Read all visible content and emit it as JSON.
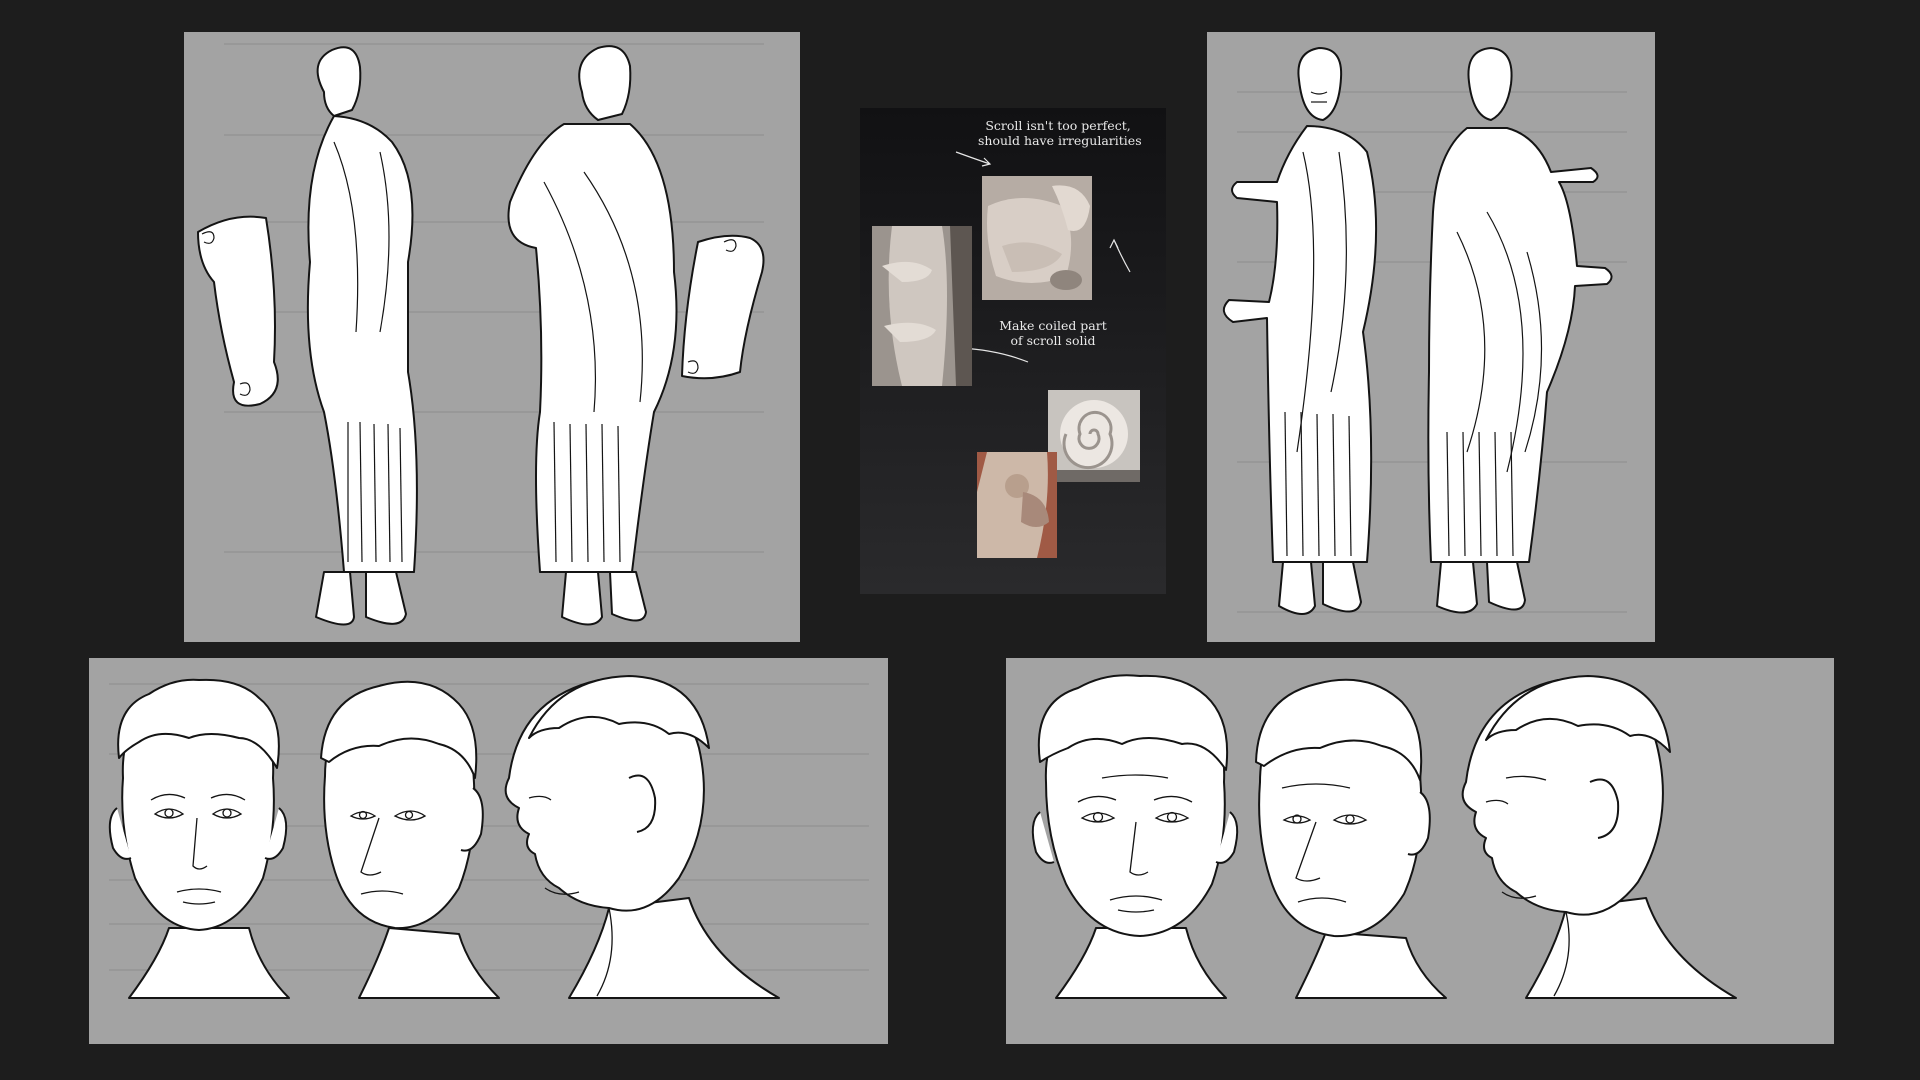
{
  "board": {
    "background_color": "#1d1d1d",
    "panel_color": "#a3a3a3",
    "line_color": "#141414"
  },
  "annotations": {
    "scroll_note": {
      "line1": "Scroll isn't too perfect,",
      "line2": "should have irregularities"
    },
    "coil_note": {
      "line1": "Make coiled part",
      "line2": "of scroll solid"
    }
  },
  "panels": [
    {
      "id": "full-body-scroll",
      "subject": "young man in toga holding scroll, side and three-quarter back views"
    },
    {
      "id": "full-body-pointing",
      "subject": "older man in toga pointing, front three-quarter and back views"
    },
    {
      "id": "head-turnaround-1",
      "subject": "young head: front, three-quarter, profile"
    },
    {
      "id": "head-turnaround-2",
      "subject": "older head: front, three-quarter, profile"
    }
  ]
}
